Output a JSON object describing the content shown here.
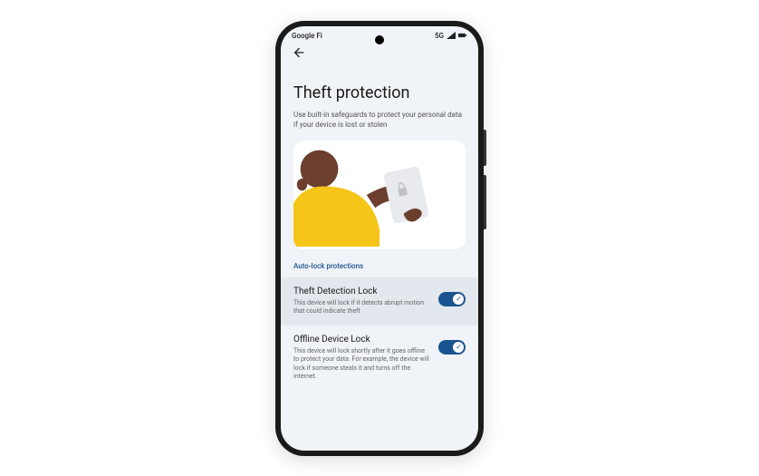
{
  "statusBar": {
    "carrier": "Google Fi",
    "network": "5G"
  },
  "page": {
    "title": "Theft protection",
    "subtitle": "Use built-in safeguards to protect your personal data if your device is lost or stolen"
  },
  "sectionHeader": "Auto-lock protections",
  "settings": [
    {
      "title": "Theft Detection Lock",
      "description": "This device will lock if it detects abrupt motion that could indicate theft",
      "enabled": true
    },
    {
      "title": "Offline Device Lock",
      "description": "This device will lock shortly after it goes offline to protect your data. For example, the device will lock if someone steals it and turns off the internet.",
      "enabled": true
    }
  ]
}
